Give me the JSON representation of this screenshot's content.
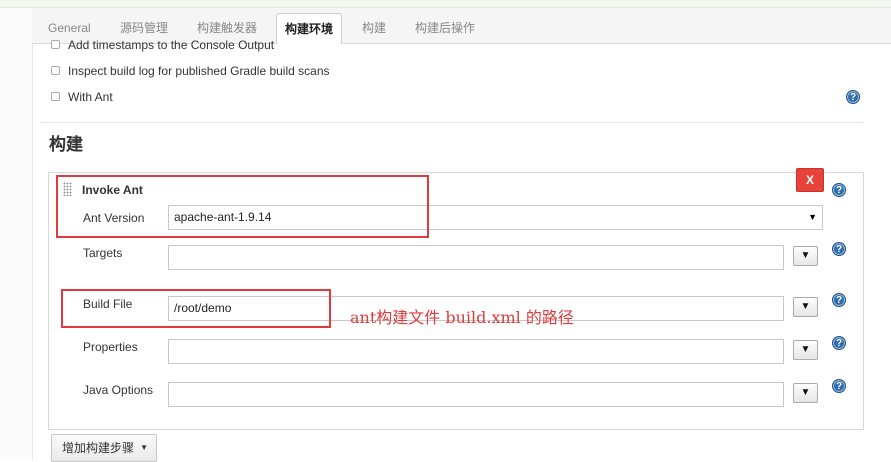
{
  "tabs": [
    {
      "label": "General",
      "active": false
    },
    {
      "label": "源码管理",
      "active": false
    },
    {
      "label": "构建触发器",
      "active": false
    },
    {
      "label": "构建环境",
      "active": true
    },
    {
      "label": "构建",
      "active": false
    },
    {
      "label": "构建后操作",
      "active": false
    }
  ],
  "env_options": [
    {
      "label": "Add timestamps to the Console Output",
      "checked": false
    },
    {
      "label": "Inspect build log for published Gradle build scans",
      "checked": false
    },
    {
      "label": "With Ant",
      "checked": false
    }
  ],
  "help_glyph": "?",
  "build": {
    "section_title": "构建",
    "step": {
      "title": "Invoke Ant",
      "delete_label": "X",
      "fields": {
        "ant_version": {
          "label": "Ant Version",
          "value": "apache-ant-1.9.14"
        },
        "targets": {
          "label": "Targets",
          "value": ""
        },
        "build_file": {
          "label": "Build File",
          "value": "/root/demo"
        },
        "properties": {
          "label": "Properties",
          "value": ""
        },
        "java_options": {
          "label": "Java Options",
          "value": ""
        }
      },
      "expand_glyph": "▼"
    },
    "add_step_label": "增加构建步骤"
  },
  "annotation": "ant构建文件 build.xml 的路径",
  "colors": {
    "annotation_red": "#e03a3a",
    "delete_button": "#e8433a",
    "help_blue": "#2f6ca8"
  },
  "icons": {
    "help": "question-circle-icon",
    "drag_handle": "grip-dots-icon",
    "dropdown": "caret-down-icon"
  }
}
